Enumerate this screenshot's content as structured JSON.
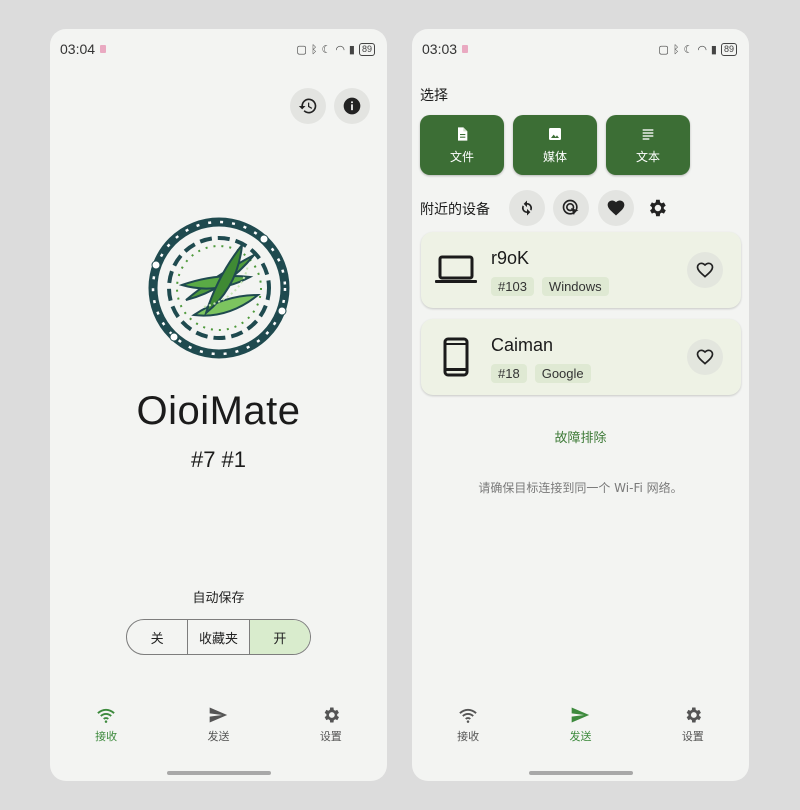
{
  "left_phone": {
    "status": {
      "time": "03:04",
      "battery": "89"
    },
    "app_title": "OioiMate",
    "app_subtitle": "#7 #1",
    "autosave_label": "自动保存",
    "segments": [
      {
        "label": "关",
        "active": false
      },
      {
        "label": "收藏夹",
        "active": false
      },
      {
        "label": "开",
        "active": true
      }
    ],
    "nav": [
      {
        "label": "接收",
        "icon": "wifi-icon",
        "active": true
      },
      {
        "label": "发送",
        "icon": "send-icon",
        "active": false
      },
      {
        "label": "设置",
        "icon": "gear-icon",
        "active": false
      }
    ]
  },
  "right_phone": {
    "status": {
      "time": "03:03",
      "battery": "89"
    },
    "select_label": "选择",
    "select_buttons": [
      {
        "label": "文件",
        "icon": "file-icon"
      },
      {
        "label": "媒体",
        "icon": "image-icon"
      },
      {
        "label": "文本",
        "icon": "text-icon"
      }
    ],
    "nearby_label": "附近的设备",
    "devices": [
      {
        "name": "r9oK",
        "tags": [
          "#103",
          "Windows"
        ],
        "icon": "laptop-icon"
      },
      {
        "name": "Caiman",
        "tags": [
          "#18",
          "Google"
        ],
        "icon": "phone-icon"
      }
    ],
    "troubleshoot": "故障排除",
    "hint": "请确保目标连接到同一个 Wi-Fi 网络。",
    "nav": [
      {
        "label": "接收",
        "icon": "wifi-icon",
        "active": false
      },
      {
        "label": "发送",
        "icon": "send-icon",
        "active": true
      },
      {
        "label": "设置",
        "icon": "gear-icon",
        "active": false
      }
    ]
  },
  "colors": {
    "accent": "#3c6e35",
    "nav_active": "#3d8a3d",
    "logo_ring": "#1f4a4f",
    "logo_leaf": "#4f9a3c"
  }
}
